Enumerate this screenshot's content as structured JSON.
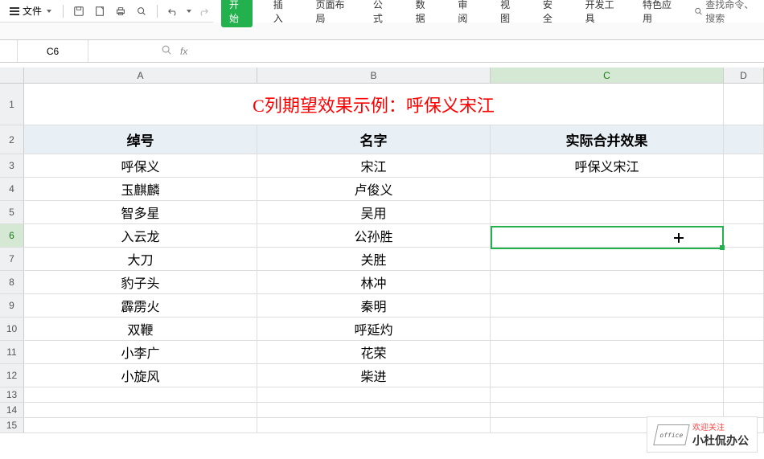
{
  "toolbar": {
    "file_label": "文件"
  },
  "ribbon": {
    "tabs": [
      "开始",
      "插入",
      "页面布局",
      "公式",
      "数据",
      "审阅",
      "视图",
      "安全",
      "开发工具",
      "特色应用"
    ],
    "search_placeholder": "查找命令、搜索"
  },
  "namebox": {
    "value": "C6"
  },
  "formula_bar": {
    "fx_label": "fx"
  },
  "columns": [
    "A",
    "B",
    "C",
    "D"
  ],
  "title_cell": "C列期望效果示例：呼保义宋江",
  "headers": {
    "a": "绰号",
    "b": "名字",
    "c": "实际合并效果"
  },
  "rows": [
    {
      "n": "3",
      "a": "呼保义",
      "b": "宋江",
      "c": "呼保义宋江"
    },
    {
      "n": "4",
      "a": "玉麒麟",
      "b": "卢俊义",
      "c": ""
    },
    {
      "n": "5",
      "a": "智多星",
      "b": "吴用",
      "c": ""
    },
    {
      "n": "6",
      "a": "入云龙",
      "b": "公孙胜",
      "c": ""
    },
    {
      "n": "7",
      "a": "大刀",
      "b": "关胜",
      "c": ""
    },
    {
      "n": "8",
      "a": "豹子头",
      "b": "林冲",
      "c": ""
    },
    {
      "n": "9",
      "a": "霹雳火",
      "b": "秦明",
      "c": ""
    },
    {
      "n": "10",
      "a": "双鞭",
      "b": "呼延灼",
      "c": ""
    },
    {
      "n": "11",
      "a": "小李广",
      "b": "花荣",
      "c": ""
    },
    {
      "n": "12",
      "a": "小旋风",
      "b": "柴进",
      "c": ""
    }
  ],
  "empty_rows": [
    "13",
    "14",
    "15"
  ],
  "selected": {
    "cell": "C6"
  },
  "watermark": {
    "logo_text": "office",
    "line1": "欢迎关注",
    "line2": "小杜侃办公"
  }
}
